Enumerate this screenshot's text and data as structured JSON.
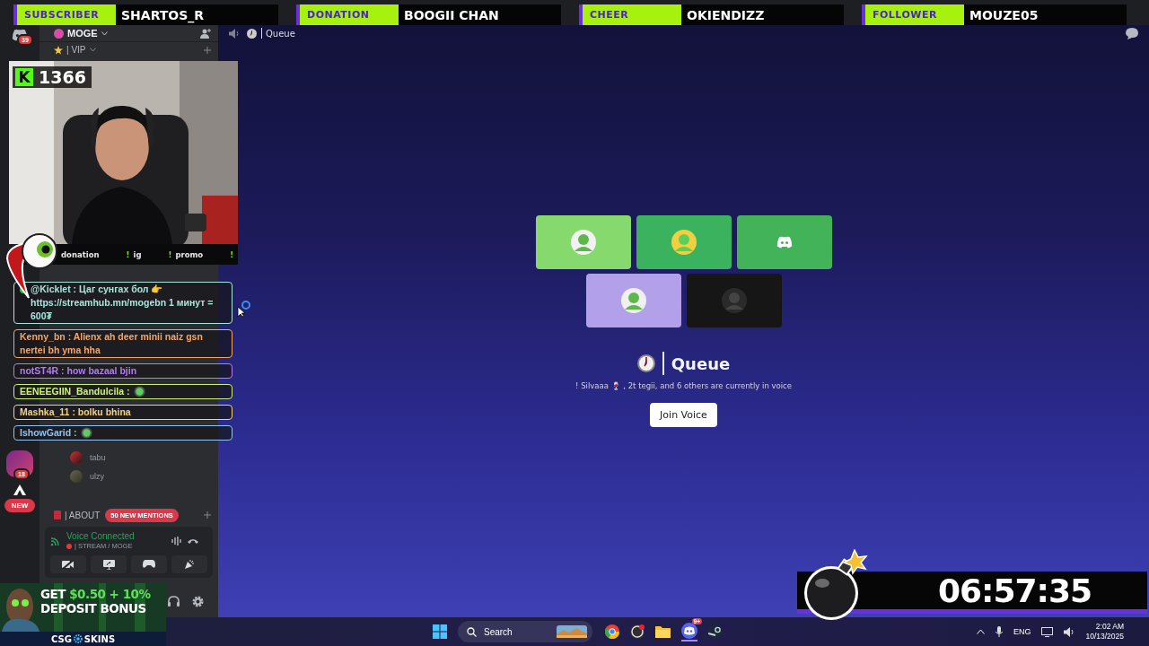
{
  "alerts": [
    {
      "label": "SUBSCRIBER",
      "name": "SHARTOS_R"
    },
    {
      "label": "DONATION",
      "name": "BOOGII CHAN"
    },
    {
      "label": "CHEER",
      "name": "OKIENDIZZ"
    },
    {
      "label": "FOLLOWER",
      "name": "MOUZE05"
    }
  ],
  "rail": {
    "home_badge": "39",
    "server_badge": "18",
    "new_pill": "NEW"
  },
  "sidebar": {
    "server": "MOGE",
    "top_channel": "| VIP",
    "members": [
      "tabu",
      "ulzy"
    ],
    "bottom_channel": "| ABOUT",
    "mentions": "50 NEW MENTIONS"
  },
  "voice_panel": {
    "status": "Voice Connected",
    "channel": "| STREAM / MOGE"
  },
  "header": {
    "channel": "Queue"
  },
  "tiles": [
    {
      "color": "#86d96c",
      "kind": "avatar"
    },
    {
      "color": "#3bb35e",
      "kind": "avatar"
    },
    {
      "color": "#43b35a",
      "kind": "logo"
    },
    {
      "color": "#b2a0ea",
      "kind": "avatar"
    },
    {
      "color": "#161616",
      "kind": "avatar"
    }
  ],
  "queue": {
    "title": "Queue",
    "subtitle": "! Silvaaa 🍷 , 2t tegii, and 6 others are currently in voice",
    "button": "Join Voice"
  },
  "cam": {
    "kick_mark": "K",
    "viewers": "1366"
  },
  "commands": [
    {
      "text": "donation"
    },
    {
      "mark": "!",
      "text": "ig"
    },
    {
      "mark": "!",
      "text": "promo"
    },
    {
      "mark": "!"
    }
  ],
  "chat": [
    {
      "line": "@Kicklet : Цаг сунгах бол 👉 https://streamhub.mn/mogebn 1 минут = 600₮",
      "color": "#a9e6dc",
      "verified": true,
      "emote": false
    },
    {
      "line": "Kenny_bn : Alienx ah deer minii naiz gsn nertei bh yma hha",
      "color": "#f4a766",
      "verified": false,
      "emote": false
    },
    {
      "line": "notST4R : how bazaal bjin",
      "color": "#b27cf2",
      "verified": false,
      "emote": false
    },
    {
      "line": "EENEEGIIN_Bandulcila :",
      "color": "#cdf27a",
      "verified": false,
      "emote": true
    },
    {
      "line": "Mashka_11 : bolku bhina",
      "color": "#f5d27d",
      "verified": false,
      "emote": false
    },
    {
      "line": "IshowGarid :",
      "color": "#93c2f2",
      "verified": false,
      "emote": true
    }
  ],
  "ad": {
    "lead": "GET",
    "highlight": "$0.50 + 10%",
    "line2": "DEPOSIT BONUS",
    "brand_left": "CSG",
    "brand_right": "SKINS"
  },
  "timer": "06:57:35",
  "taskbar": {
    "search": "Search",
    "discord_badge": "9+",
    "lang": "ENG",
    "time": "2:02 AM",
    "date": "10/13/2025"
  }
}
